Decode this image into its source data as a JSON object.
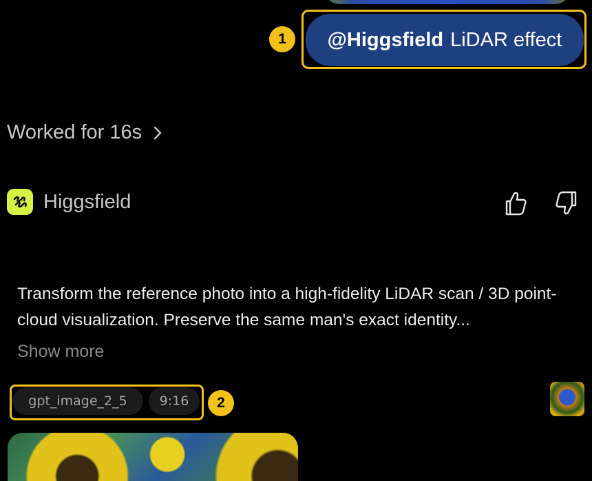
{
  "prompt": {
    "mention": "@Higgsfield",
    "text": "LiDAR effect"
  },
  "markers": [
    "1",
    "2"
  ],
  "worked": {
    "label": "Worked for 16s"
  },
  "agent": {
    "name": "Higgsfield"
  },
  "message": {
    "text": "Transform the reference photo into a high-fidelity LiDAR scan / 3D point-cloud visualization. Preserve the same man's exact identity...",
    "show_more": "Show more"
  },
  "tags": {
    "model": "gpt_image_2_5",
    "ratio": "9:16"
  },
  "colors": {
    "bubble": "#1e3f80",
    "highlight": "#f2c21b",
    "agent_logo": "#d6f245"
  },
  "icons": [
    "chevron-right-icon",
    "higgsfield-logo-icon",
    "thumbs-up-icon",
    "thumbs-down-icon"
  ]
}
